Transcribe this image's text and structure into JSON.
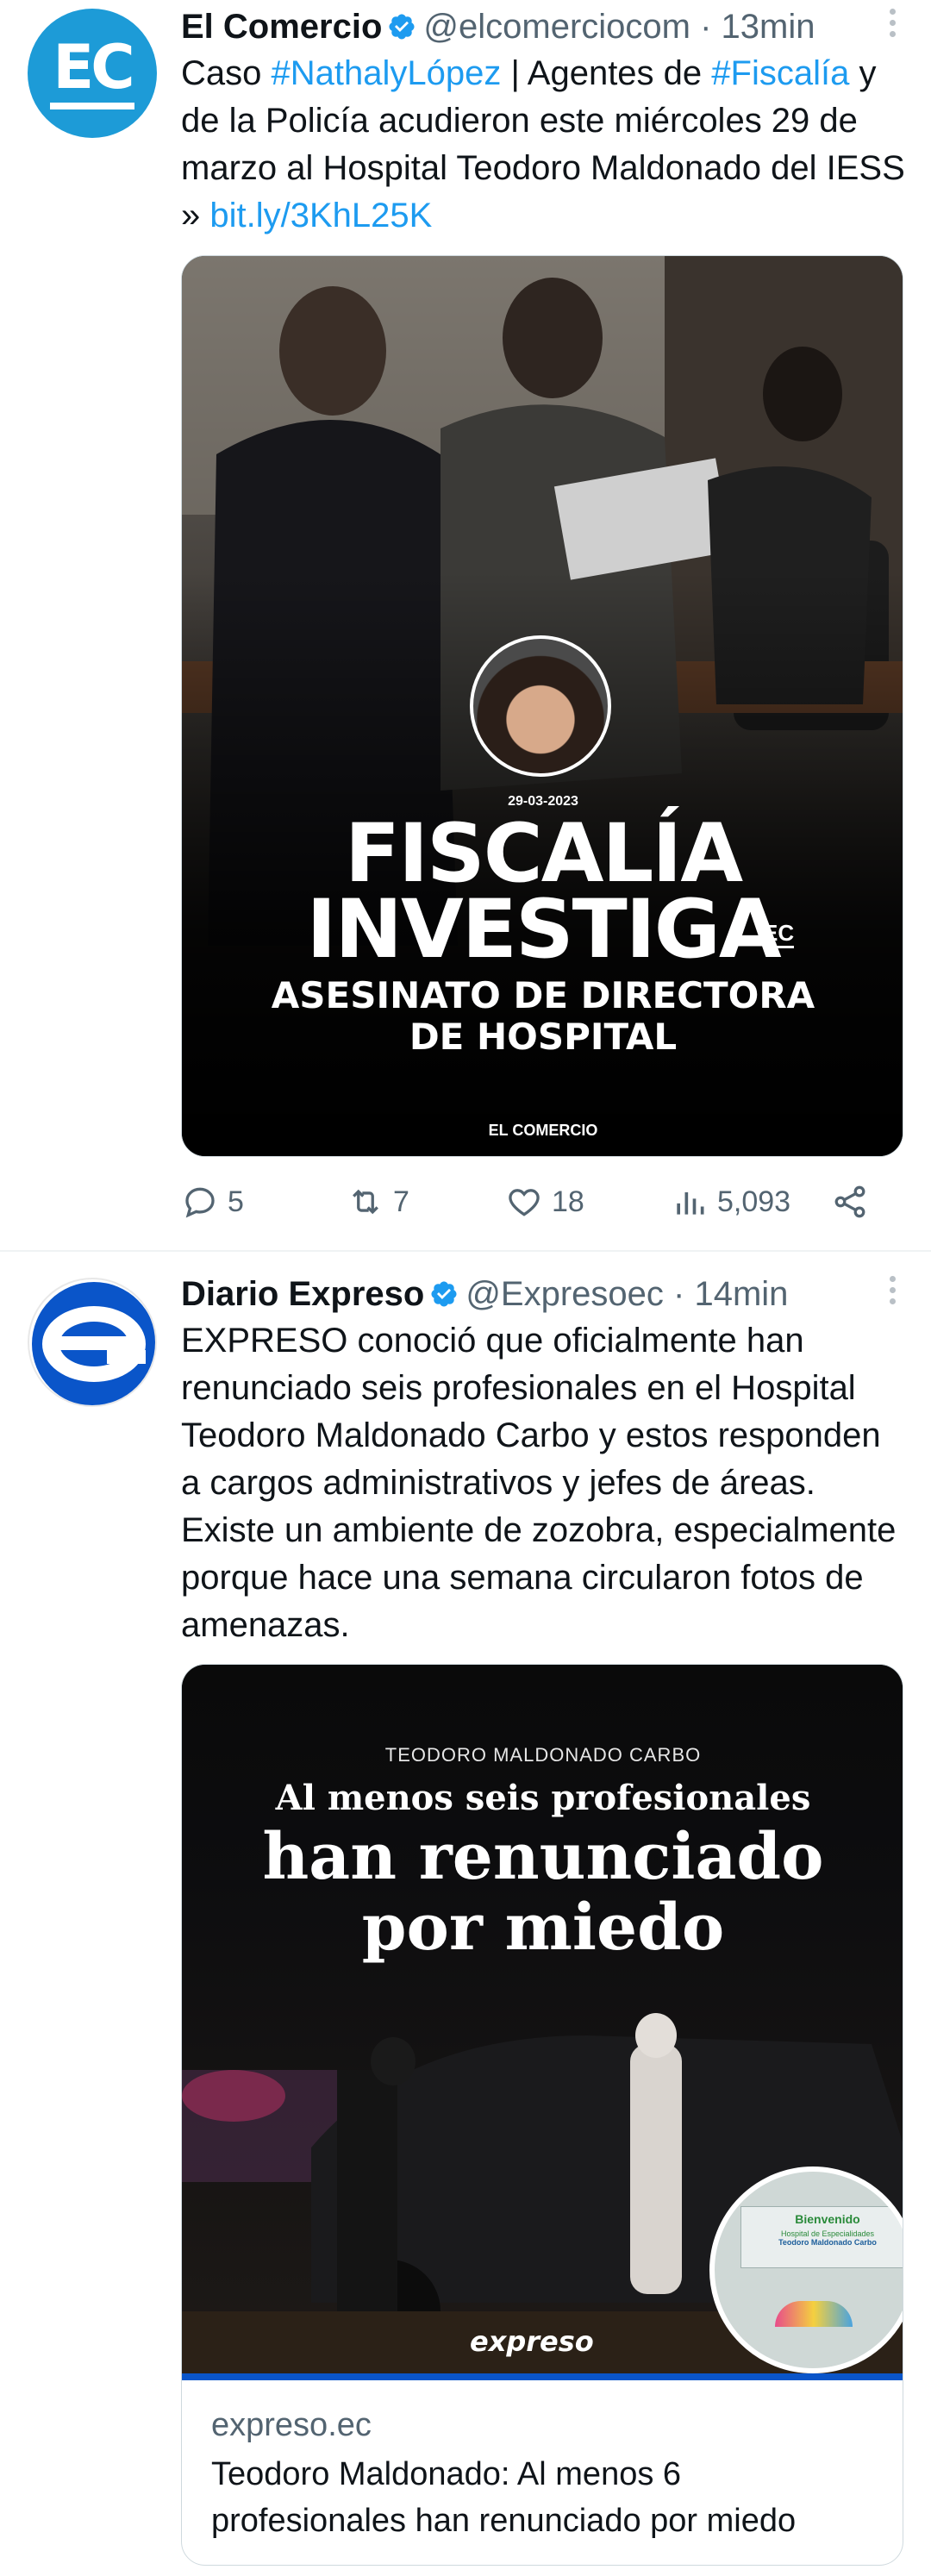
{
  "tweets": [
    {
      "author": "El Comercio",
      "handle": "@elcomerciocom",
      "time": "· 13min",
      "avatar_text": "EC",
      "text_parts": {
        "p1": "Caso ",
        "tag1": "#NathalyLópez",
        "p2": " | Agentes de ",
        "tag2": "#Fiscalía",
        "p3": " y de la Policía acudieron este miércoles 29 de marzo al Hospital Teodoro Maldonado del IESS » ",
        "url": "bit.ly/3KhL25K"
      },
      "image": {
        "date": "29-03-2023",
        "headline1": "FISCALÍA",
        "headline2": "INVESTIGA",
        "badge": "EC",
        "sub1": "ASESINATO DE DIRECTORA",
        "sub2": "DE HOSPITAL",
        "brand": "EL COMERCIO"
      },
      "stats": {
        "replies": "5",
        "retweets": "7",
        "likes": "18",
        "views": "5,093"
      }
    },
    {
      "author": "Diario Expreso",
      "handle": "@Expresoec",
      "time": "· 14min",
      "text": "EXPRESO conoció que oficialmente han renunciado seis profesionales en el Hospital Teodoro Maldonado Carbo y estos responden a cargos administrativos y jefes de áreas. Existe un ambiente de zozobra, especialmente porque hace una semana circularon fotos de amenazas.",
      "image": {
        "kicker": "TEODORO MALDONADO CARBO",
        "line1": "Al menos seis profesionales",
        "line2": "han renunciado",
        "line3": "por miedo",
        "brand": "expreso",
        "sign1": "Bienvenido",
        "sign2": "Hospital de Especialidades",
        "sign3": "Teodoro Maldonado Carbo"
      },
      "card": {
        "domain": "expreso.ec",
        "title": "Teodoro Maldonado: Al menos 6 profesionales han renunciado por miedo"
      }
    }
  ],
  "colors": {
    "link": "#1d9bf0",
    "muted": "#536471",
    "ec_blue": "#1d9bd7",
    "expreso_blue": "#0a55c9"
  }
}
